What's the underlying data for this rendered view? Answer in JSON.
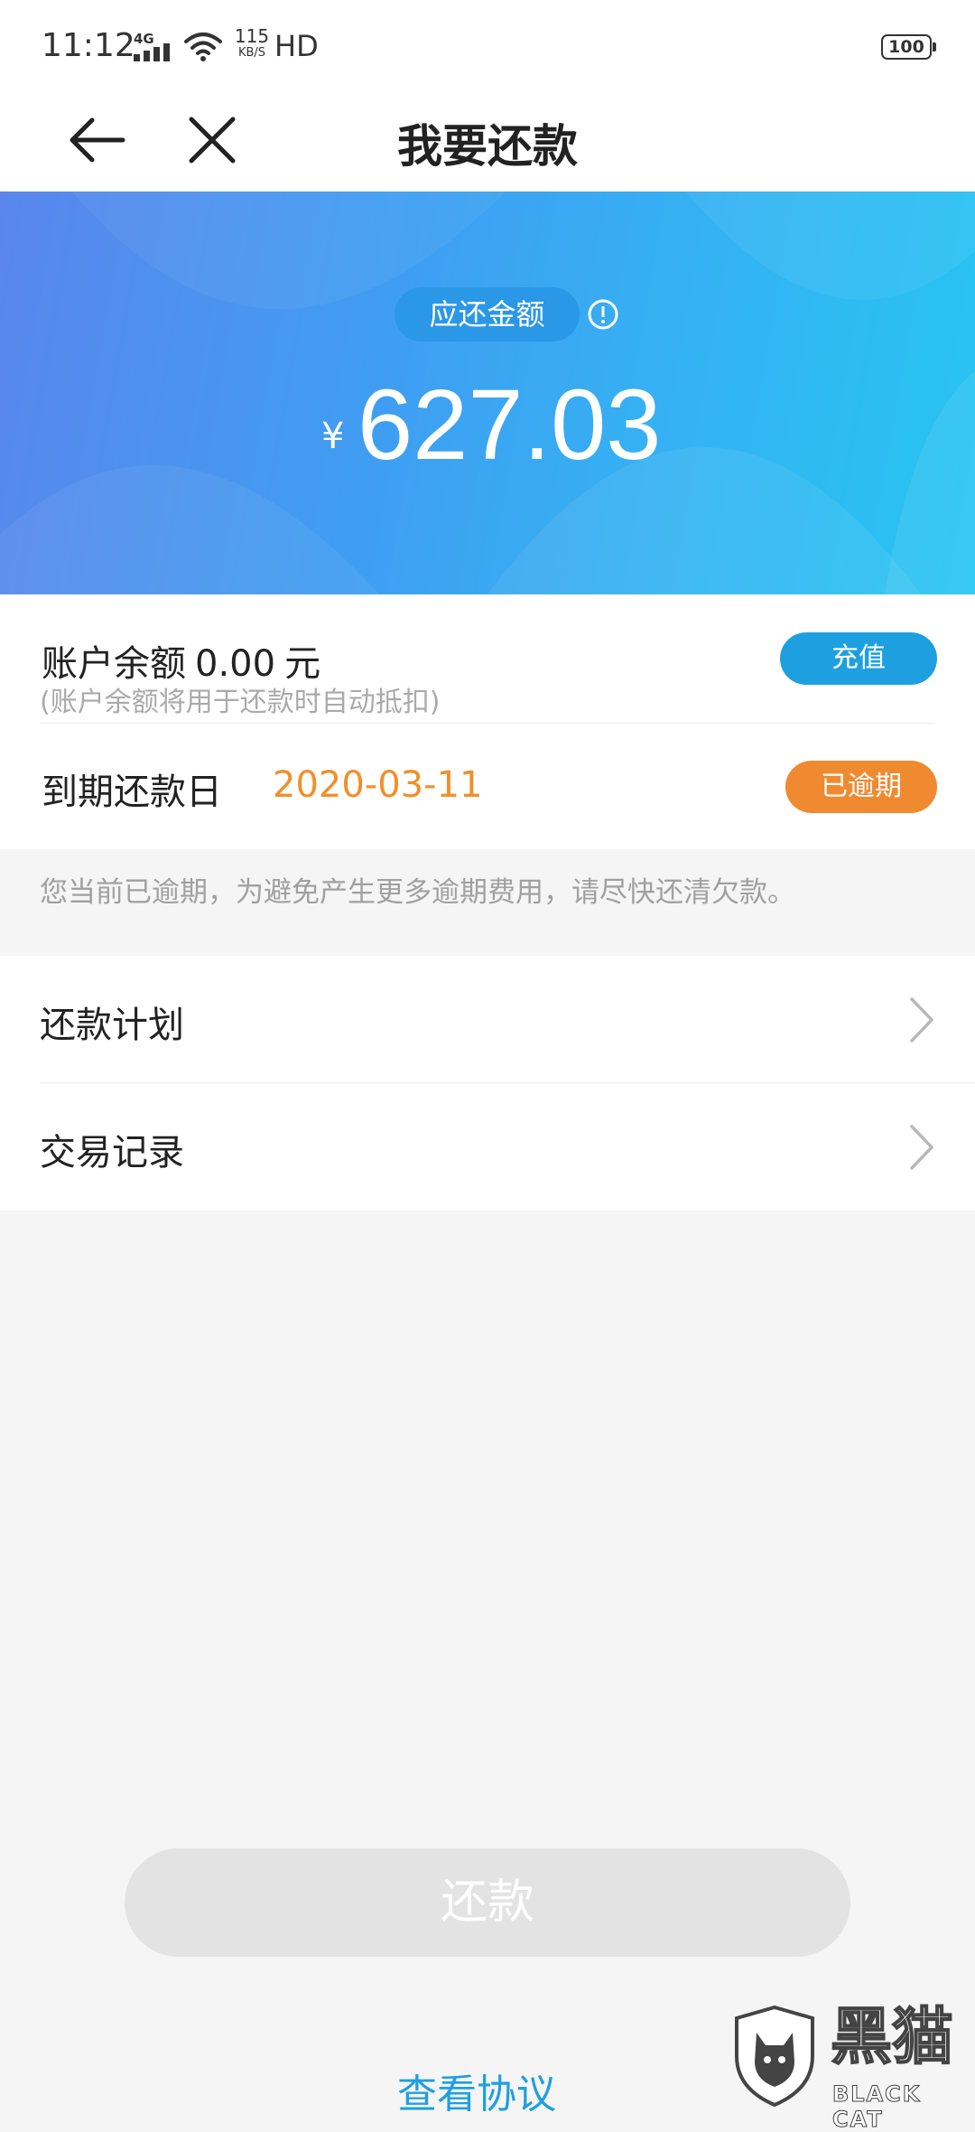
{
  "status_bar": {
    "time": "11:12",
    "network": "4G",
    "speed_value": "115",
    "speed_unit": "KB/S",
    "hd": "HD",
    "battery": "100"
  },
  "nav": {
    "title": "我要还款",
    "back_icon": "back-arrow-icon",
    "close_icon": "close-icon"
  },
  "amount": {
    "label": "应还金额",
    "currency": "¥",
    "value": "627.03",
    "info_icon": "info-icon"
  },
  "balance": {
    "label": "账户余额",
    "value": "0.00",
    "unit": "元",
    "hint": "(账户余额将用于还款时自动抵扣)",
    "recharge_label": "充值"
  },
  "due": {
    "label": "到期还款日",
    "date": "2020-03-11",
    "status": "已逾期"
  },
  "warning": "您当前已逾期，为避免产生更多逾期费用，请尽快还清欠款。",
  "menu": [
    {
      "label": "还款计划"
    },
    {
      "label": "交易记录"
    }
  ],
  "actions": {
    "pay_label": "还款",
    "agreement_label": "查看协议"
  },
  "watermark": {
    "name": "黑猫",
    "name_en": "BLACK CAT"
  },
  "colors": {
    "accent_blue": "#1e9fe0",
    "overdue_orange": "#f08a30",
    "date_orange": "#f0902a",
    "disabled_gray": "#e3e3e3"
  }
}
